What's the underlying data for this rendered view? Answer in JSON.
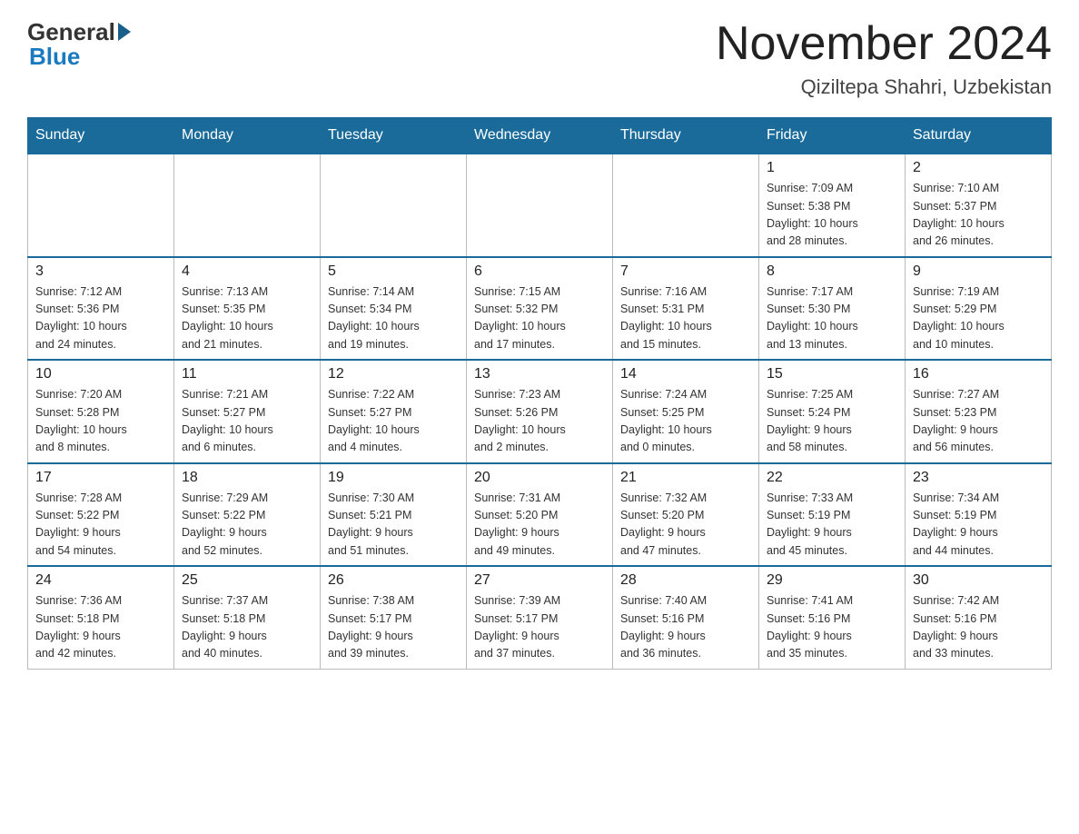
{
  "header": {
    "logo_general": "General",
    "logo_blue": "Blue",
    "title": "November 2024",
    "subtitle": "Qiziltepa Shahri, Uzbekistan"
  },
  "weekdays": [
    "Sunday",
    "Monday",
    "Tuesday",
    "Wednesday",
    "Thursday",
    "Friday",
    "Saturday"
  ],
  "weeks": [
    [
      {
        "day": "",
        "info": ""
      },
      {
        "day": "",
        "info": ""
      },
      {
        "day": "",
        "info": ""
      },
      {
        "day": "",
        "info": ""
      },
      {
        "day": "",
        "info": ""
      },
      {
        "day": "1",
        "info": "Sunrise: 7:09 AM\nSunset: 5:38 PM\nDaylight: 10 hours\nand 28 minutes."
      },
      {
        "day": "2",
        "info": "Sunrise: 7:10 AM\nSunset: 5:37 PM\nDaylight: 10 hours\nand 26 minutes."
      }
    ],
    [
      {
        "day": "3",
        "info": "Sunrise: 7:12 AM\nSunset: 5:36 PM\nDaylight: 10 hours\nand 24 minutes."
      },
      {
        "day": "4",
        "info": "Sunrise: 7:13 AM\nSunset: 5:35 PM\nDaylight: 10 hours\nand 21 minutes."
      },
      {
        "day": "5",
        "info": "Sunrise: 7:14 AM\nSunset: 5:34 PM\nDaylight: 10 hours\nand 19 minutes."
      },
      {
        "day": "6",
        "info": "Sunrise: 7:15 AM\nSunset: 5:32 PM\nDaylight: 10 hours\nand 17 minutes."
      },
      {
        "day": "7",
        "info": "Sunrise: 7:16 AM\nSunset: 5:31 PM\nDaylight: 10 hours\nand 15 minutes."
      },
      {
        "day": "8",
        "info": "Sunrise: 7:17 AM\nSunset: 5:30 PM\nDaylight: 10 hours\nand 13 minutes."
      },
      {
        "day": "9",
        "info": "Sunrise: 7:19 AM\nSunset: 5:29 PM\nDaylight: 10 hours\nand 10 minutes."
      }
    ],
    [
      {
        "day": "10",
        "info": "Sunrise: 7:20 AM\nSunset: 5:28 PM\nDaylight: 10 hours\nand 8 minutes."
      },
      {
        "day": "11",
        "info": "Sunrise: 7:21 AM\nSunset: 5:27 PM\nDaylight: 10 hours\nand 6 minutes."
      },
      {
        "day": "12",
        "info": "Sunrise: 7:22 AM\nSunset: 5:27 PM\nDaylight: 10 hours\nand 4 minutes."
      },
      {
        "day": "13",
        "info": "Sunrise: 7:23 AM\nSunset: 5:26 PM\nDaylight: 10 hours\nand 2 minutes."
      },
      {
        "day": "14",
        "info": "Sunrise: 7:24 AM\nSunset: 5:25 PM\nDaylight: 10 hours\nand 0 minutes."
      },
      {
        "day": "15",
        "info": "Sunrise: 7:25 AM\nSunset: 5:24 PM\nDaylight: 9 hours\nand 58 minutes."
      },
      {
        "day": "16",
        "info": "Sunrise: 7:27 AM\nSunset: 5:23 PM\nDaylight: 9 hours\nand 56 minutes."
      }
    ],
    [
      {
        "day": "17",
        "info": "Sunrise: 7:28 AM\nSunset: 5:22 PM\nDaylight: 9 hours\nand 54 minutes."
      },
      {
        "day": "18",
        "info": "Sunrise: 7:29 AM\nSunset: 5:22 PM\nDaylight: 9 hours\nand 52 minutes."
      },
      {
        "day": "19",
        "info": "Sunrise: 7:30 AM\nSunset: 5:21 PM\nDaylight: 9 hours\nand 51 minutes."
      },
      {
        "day": "20",
        "info": "Sunrise: 7:31 AM\nSunset: 5:20 PM\nDaylight: 9 hours\nand 49 minutes."
      },
      {
        "day": "21",
        "info": "Sunrise: 7:32 AM\nSunset: 5:20 PM\nDaylight: 9 hours\nand 47 minutes."
      },
      {
        "day": "22",
        "info": "Sunrise: 7:33 AM\nSunset: 5:19 PM\nDaylight: 9 hours\nand 45 minutes."
      },
      {
        "day": "23",
        "info": "Sunrise: 7:34 AM\nSunset: 5:19 PM\nDaylight: 9 hours\nand 44 minutes."
      }
    ],
    [
      {
        "day": "24",
        "info": "Sunrise: 7:36 AM\nSunset: 5:18 PM\nDaylight: 9 hours\nand 42 minutes."
      },
      {
        "day": "25",
        "info": "Sunrise: 7:37 AM\nSunset: 5:18 PM\nDaylight: 9 hours\nand 40 minutes."
      },
      {
        "day": "26",
        "info": "Sunrise: 7:38 AM\nSunset: 5:17 PM\nDaylight: 9 hours\nand 39 minutes."
      },
      {
        "day": "27",
        "info": "Sunrise: 7:39 AM\nSunset: 5:17 PM\nDaylight: 9 hours\nand 37 minutes."
      },
      {
        "day": "28",
        "info": "Sunrise: 7:40 AM\nSunset: 5:16 PM\nDaylight: 9 hours\nand 36 minutes."
      },
      {
        "day": "29",
        "info": "Sunrise: 7:41 AM\nSunset: 5:16 PM\nDaylight: 9 hours\nand 35 minutes."
      },
      {
        "day": "30",
        "info": "Sunrise: 7:42 AM\nSunset: 5:16 PM\nDaylight: 9 hours\nand 33 minutes."
      }
    ]
  ]
}
